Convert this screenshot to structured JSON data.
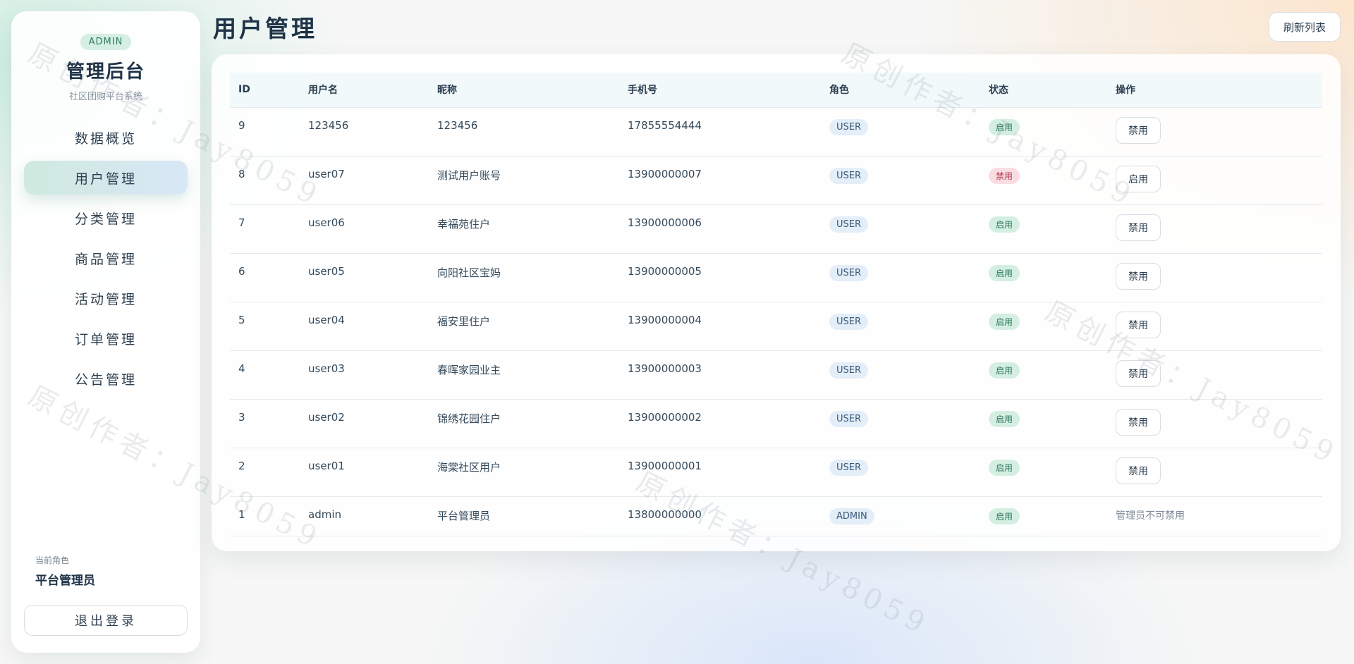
{
  "sidebar": {
    "badge": "ADMIN",
    "title": "管理后台",
    "subtitle": "社区团购平台系统",
    "nav": [
      {
        "label": "数据概览",
        "active": false
      },
      {
        "label": "用户管理",
        "active": true
      },
      {
        "label": "分类管理",
        "active": false
      },
      {
        "label": "商品管理",
        "active": false
      },
      {
        "label": "活动管理",
        "active": false
      },
      {
        "label": "订单管理",
        "active": false
      },
      {
        "label": "公告管理",
        "active": false
      }
    ],
    "role_label": "当前角色",
    "role_value": "平台管理员",
    "logout_label": "退出登录"
  },
  "header": {
    "title": "用户管理",
    "refresh_label": "刷新列表"
  },
  "table": {
    "columns": [
      "ID",
      "用户名",
      "昵称",
      "手机号",
      "角色",
      "状态",
      "操作"
    ],
    "rows": [
      {
        "id": "9",
        "username": "123456",
        "nickname": "123456",
        "phone": "17855554444",
        "role": "USER",
        "status": "启用",
        "status_type": "on",
        "action": "禁用"
      },
      {
        "id": "8",
        "username": "user07",
        "nickname": "测试用户账号",
        "phone": "13900000007",
        "role": "USER",
        "status": "禁用",
        "status_type": "off",
        "action": "启用"
      },
      {
        "id": "7",
        "username": "user06",
        "nickname": "幸福苑住户",
        "phone": "13900000006",
        "role": "USER",
        "status": "启用",
        "status_type": "on",
        "action": "禁用"
      },
      {
        "id": "6",
        "username": "user05",
        "nickname": "向阳社区宝妈",
        "phone": "13900000005",
        "role": "USER",
        "status": "启用",
        "status_type": "on",
        "action": "禁用"
      },
      {
        "id": "5",
        "username": "user04",
        "nickname": "福安里住户",
        "phone": "13900000004",
        "role": "USER",
        "status": "启用",
        "status_type": "on",
        "action": "禁用"
      },
      {
        "id": "4",
        "username": "user03",
        "nickname": "春晖家园业主",
        "phone": "13900000003",
        "role": "USER",
        "status": "启用",
        "status_type": "on",
        "action": "禁用"
      },
      {
        "id": "3",
        "username": "user02",
        "nickname": "锦绣花园住户",
        "phone": "13900000002",
        "role": "USER",
        "status": "启用",
        "status_type": "on",
        "action": "禁用"
      },
      {
        "id": "2",
        "username": "user01",
        "nickname": "海棠社区用户",
        "phone": "13900000001",
        "role": "USER",
        "status": "启用",
        "status_type": "on",
        "action": "禁用"
      },
      {
        "id": "1",
        "username": "admin",
        "nickname": "平台管理员",
        "phone": "13800000000",
        "role": "ADMIN",
        "status": "启用",
        "status_type": "on",
        "action_note": "管理员不可禁用"
      }
    ]
  },
  "watermark": "原创作者：Jay8059"
}
